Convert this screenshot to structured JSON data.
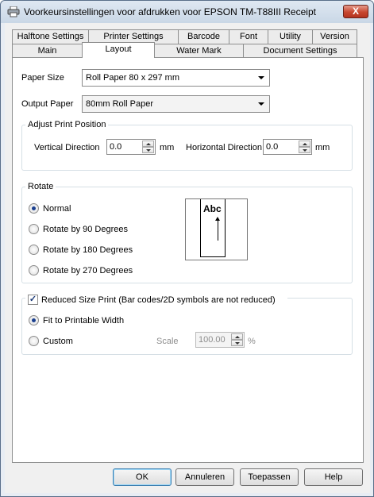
{
  "window": {
    "title": "Voorkeursinstellingen voor afdrukken voor EPSON TM-T88III Receipt",
    "close_symbol": "X"
  },
  "tabs_back": [
    "Halftone Settings",
    "Printer Settings",
    "Barcode",
    "Font",
    "Utility",
    "Version"
  ],
  "tabs_front": [
    "Main",
    "Layout",
    "Water Mark",
    "Document Settings"
  ],
  "active_tab": "Layout",
  "paper": {
    "paper_size_label": "Paper Size",
    "paper_size_value": "Roll Paper 80 x 297 mm",
    "output_paper_label": "Output Paper",
    "output_paper_value": "80mm Roll Paper"
  },
  "adjust": {
    "title": "Adjust Print Position",
    "vertical_label": "Vertical Direction",
    "vertical_value": "0.0",
    "vertical_unit": "mm",
    "horizontal_label": "Horizontal Direction",
    "horizontal_value": "0.0",
    "horizontal_unit": "mm"
  },
  "rotate": {
    "title": "Rotate",
    "options": [
      "Normal",
      "Rotate by 90 Degrees",
      "Rotate by 180 Degrees",
      "Rotate by 270 Degrees"
    ],
    "selected": "Normal",
    "preview_text": "Abc"
  },
  "reduced": {
    "checkbox_label": "Reduced Size Print (Bar codes/2D symbols are not reduced)",
    "checked": true,
    "fit_label": "Fit to Printable Width",
    "custom_label": "Custom",
    "selected": "Fit to Printable Width",
    "scale_label": "Scale",
    "scale_value": "100.00",
    "scale_unit": "%"
  },
  "buttons": {
    "ok": "OK",
    "cancel": "Annuleren",
    "apply": "Toepassen",
    "help": "Help"
  },
  "icons": {
    "title_icon": "printer-icon",
    "checkmark": "✓"
  }
}
